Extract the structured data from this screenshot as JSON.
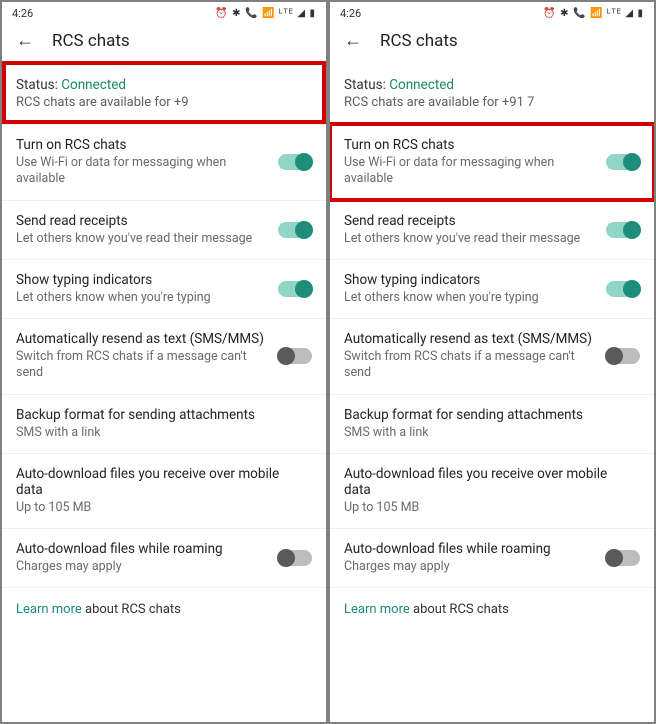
{
  "time": "4:26",
  "status_icons": "⏰ ✱ 📞 📶 ᴸᵀᴱ ◢ ▮",
  "page_title": "RCS chats",
  "back_glyph": "←",
  "status_label": "Status: ",
  "status_value": "Connected",
  "learn_link": "Learn more",
  "learn_rest": " about RCS chats",
  "settings": [
    {
      "title": "Turn on RCS chats",
      "sub": "Use Wi-Fi or data for messaging when available",
      "toggle": "on"
    },
    {
      "title": "Send read receipts",
      "sub": "Let others know you've read their message",
      "toggle": "on"
    },
    {
      "title": "Show typing indicators",
      "sub": "Let others know when you're typing",
      "toggle": "on"
    },
    {
      "title": "Automatically resend as text (SMS/MMS)",
      "sub": "Switch from RCS chats if a message can't send",
      "toggle": "off"
    },
    {
      "title": "Backup format for sending attachments",
      "sub": "SMS with a link",
      "toggle": null
    },
    {
      "title": "Auto-download files you receive over mobile data",
      "sub": "Up to 105 MB",
      "toggle": null
    },
    {
      "title": "Auto-download files while roaming",
      "sub": "Charges may apply",
      "toggle": "off"
    }
  ],
  "panels": [
    {
      "availability": "RCS chats are available for +9",
      "highlight": "status"
    },
    {
      "availability": "RCS chats are available for +91 7",
      "highlight": "first_item"
    }
  ]
}
